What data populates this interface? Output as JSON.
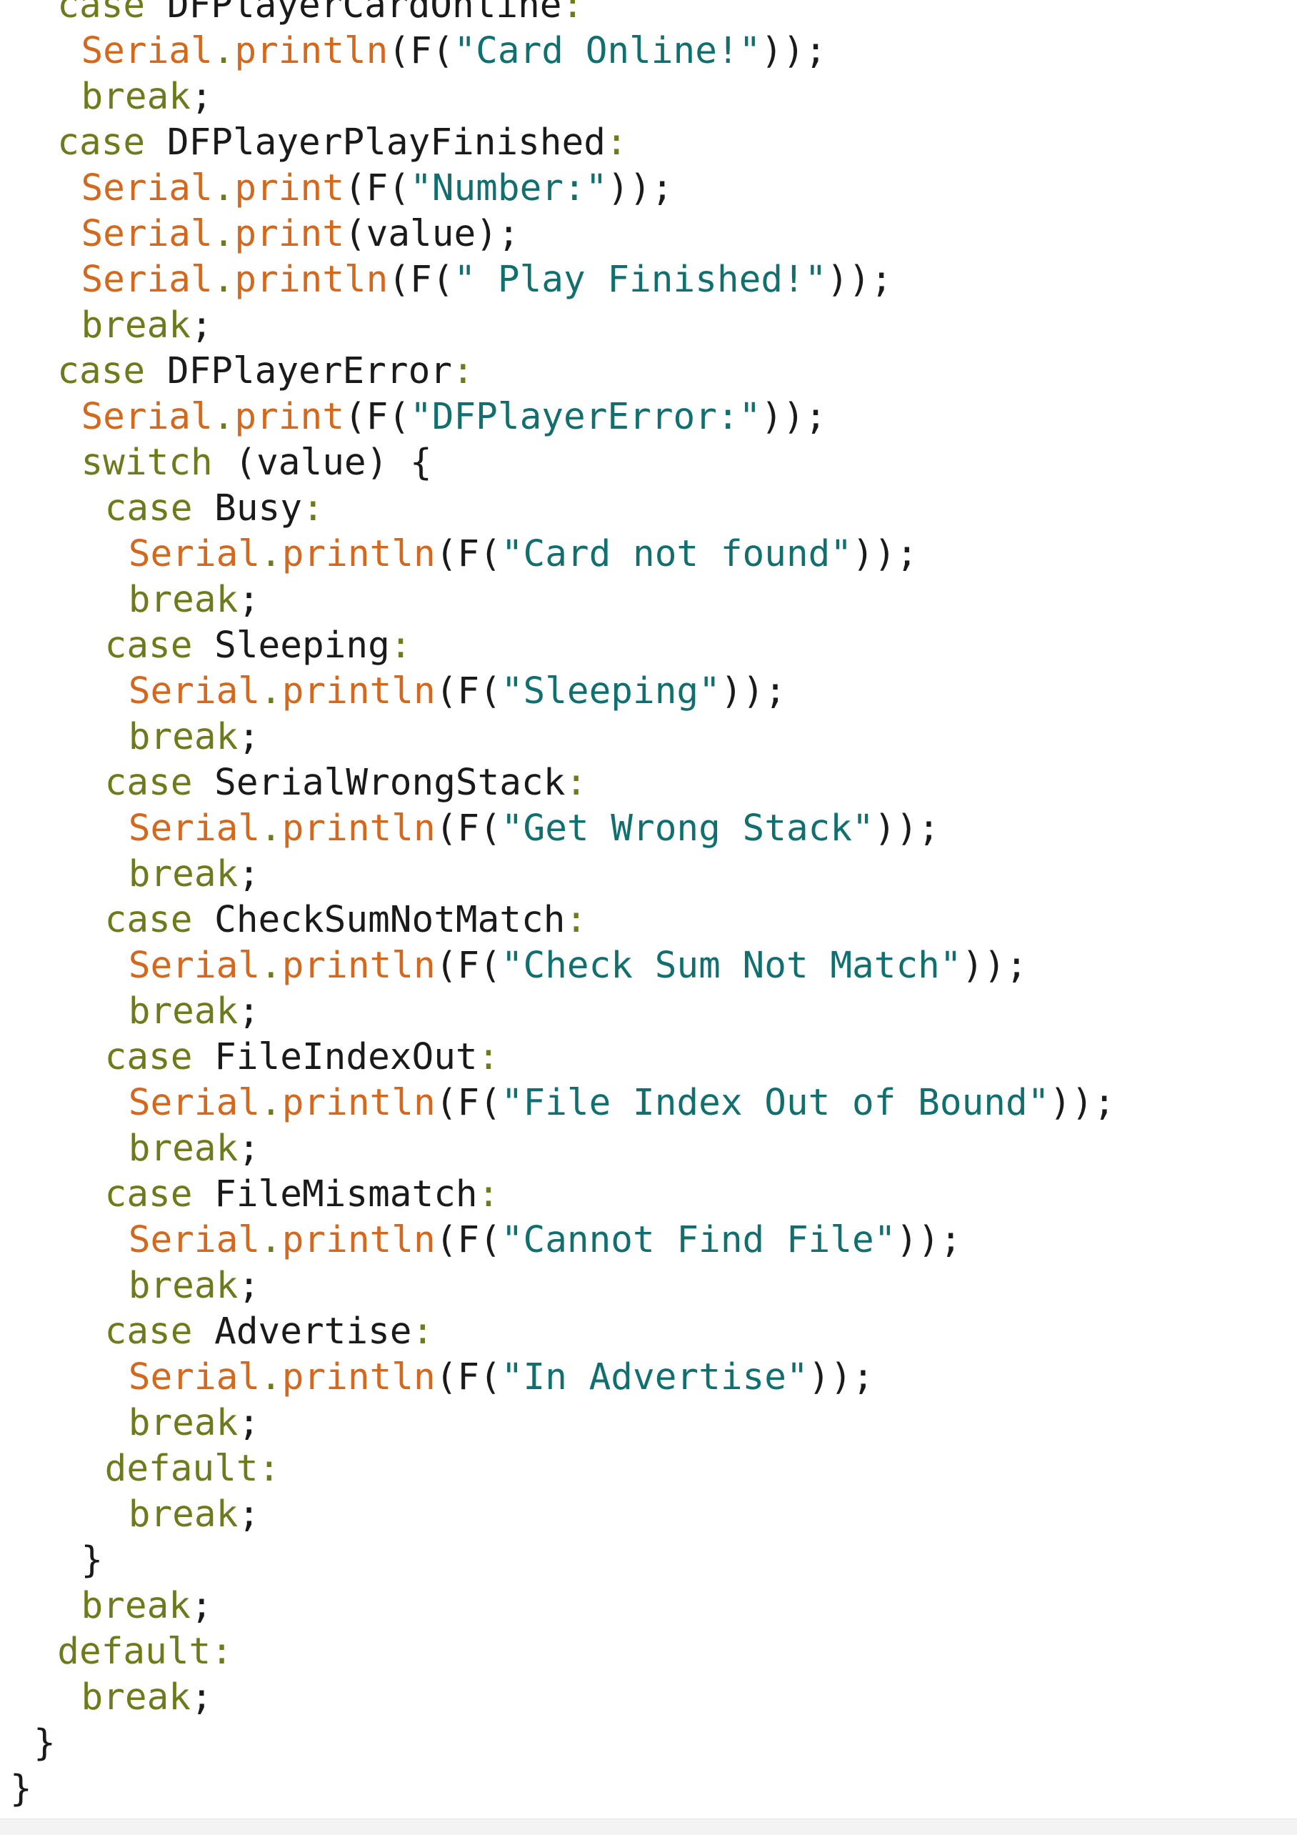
{
  "editor": {
    "colors": {
      "keyword": "#6e7a1c",
      "serial": "#d3681f",
      "string": "#11706f",
      "plain": "#1a1a1a",
      "background": "#ffffff"
    },
    "lines": [
      {
        "indent": 4,
        "tokens": [
          {
            "t": "case",
            "c": "keyword"
          },
          {
            "t": " DFPlayerCardOnline",
            "c": "plain"
          },
          {
            "t": ":",
            "c": "colon"
          }
        ]
      },
      {
        "indent": 6,
        "tokens": [
          {
            "t": "Serial",
            "c": "serial"
          },
          {
            "t": ".",
            "c": "dot"
          },
          {
            "t": "println",
            "c": "method"
          },
          {
            "t": "(F(",
            "c": "plain"
          },
          {
            "t": "\"Card Online!\"",
            "c": "string"
          },
          {
            "t": "));",
            "c": "plain"
          }
        ]
      },
      {
        "indent": 6,
        "tokens": [
          {
            "t": "break",
            "c": "keyword"
          },
          {
            "t": ";",
            "c": "plain"
          }
        ]
      },
      {
        "indent": 4,
        "tokens": [
          {
            "t": "case",
            "c": "keyword"
          },
          {
            "t": " DFPlayerPlayFinished",
            "c": "plain"
          },
          {
            "t": ":",
            "c": "colon"
          }
        ]
      },
      {
        "indent": 6,
        "tokens": [
          {
            "t": "Serial",
            "c": "serial"
          },
          {
            "t": ".",
            "c": "dot"
          },
          {
            "t": "print",
            "c": "method"
          },
          {
            "t": "(F(",
            "c": "plain"
          },
          {
            "t": "\"Number:\"",
            "c": "string"
          },
          {
            "t": "));",
            "c": "plain"
          }
        ]
      },
      {
        "indent": 6,
        "tokens": [
          {
            "t": "Serial",
            "c": "serial"
          },
          {
            "t": ".",
            "c": "dot"
          },
          {
            "t": "print",
            "c": "method"
          },
          {
            "t": "(value);",
            "c": "plain"
          }
        ]
      },
      {
        "indent": 6,
        "tokens": [
          {
            "t": "Serial",
            "c": "serial"
          },
          {
            "t": ".",
            "c": "dot"
          },
          {
            "t": "println",
            "c": "method"
          },
          {
            "t": "(F(",
            "c": "plain"
          },
          {
            "t": "\" Play Finished!\"",
            "c": "string"
          },
          {
            "t": "));",
            "c": "plain"
          }
        ]
      },
      {
        "indent": 6,
        "tokens": [
          {
            "t": "break",
            "c": "keyword"
          },
          {
            "t": ";",
            "c": "plain"
          }
        ]
      },
      {
        "indent": 4,
        "tokens": [
          {
            "t": "case",
            "c": "keyword"
          },
          {
            "t": " DFPlayerError",
            "c": "plain"
          },
          {
            "t": ":",
            "c": "colon"
          }
        ]
      },
      {
        "indent": 6,
        "tokens": [
          {
            "t": "Serial",
            "c": "serial"
          },
          {
            "t": ".",
            "c": "dot"
          },
          {
            "t": "print",
            "c": "method"
          },
          {
            "t": "(F(",
            "c": "plain"
          },
          {
            "t": "\"DFPlayerError:\"",
            "c": "string"
          },
          {
            "t": "));",
            "c": "plain"
          }
        ]
      },
      {
        "indent": 6,
        "tokens": [
          {
            "t": "switch",
            "c": "keyword"
          },
          {
            "t": " (value) {",
            "c": "plain"
          }
        ]
      },
      {
        "indent": 8,
        "tokens": [
          {
            "t": "case",
            "c": "keyword"
          },
          {
            "t": " Busy",
            "c": "plain"
          },
          {
            "t": ":",
            "c": "colon"
          }
        ]
      },
      {
        "indent": 10,
        "tokens": [
          {
            "t": "Serial",
            "c": "serial"
          },
          {
            "t": ".",
            "c": "dot"
          },
          {
            "t": "println",
            "c": "method"
          },
          {
            "t": "(F(",
            "c": "plain"
          },
          {
            "t": "\"Card not found\"",
            "c": "string"
          },
          {
            "t": "));",
            "c": "plain"
          }
        ]
      },
      {
        "indent": 10,
        "tokens": [
          {
            "t": "break",
            "c": "keyword"
          },
          {
            "t": ";",
            "c": "plain"
          }
        ]
      },
      {
        "indent": 8,
        "tokens": [
          {
            "t": "case",
            "c": "keyword"
          },
          {
            "t": " Sleeping",
            "c": "plain"
          },
          {
            "t": ":",
            "c": "colon"
          }
        ]
      },
      {
        "indent": 10,
        "tokens": [
          {
            "t": "Serial",
            "c": "serial"
          },
          {
            "t": ".",
            "c": "dot"
          },
          {
            "t": "println",
            "c": "method"
          },
          {
            "t": "(F(",
            "c": "plain"
          },
          {
            "t": "\"Sleeping\"",
            "c": "string"
          },
          {
            "t": "));",
            "c": "plain"
          }
        ]
      },
      {
        "indent": 10,
        "tokens": [
          {
            "t": "break",
            "c": "keyword"
          },
          {
            "t": ";",
            "c": "plain"
          }
        ]
      },
      {
        "indent": 8,
        "tokens": [
          {
            "t": "case",
            "c": "keyword"
          },
          {
            "t": " SerialWrongStack",
            "c": "plain"
          },
          {
            "t": ":",
            "c": "colon"
          }
        ]
      },
      {
        "indent": 10,
        "tokens": [
          {
            "t": "Serial",
            "c": "serial"
          },
          {
            "t": ".",
            "c": "dot"
          },
          {
            "t": "println",
            "c": "method"
          },
          {
            "t": "(F(",
            "c": "plain"
          },
          {
            "t": "\"Get Wrong Stack\"",
            "c": "string"
          },
          {
            "t": "));",
            "c": "plain"
          }
        ]
      },
      {
        "indent": 10,
        "tokens": [
          {
            "t": "break",
            "c": "keyword"
          },
          {
            "t": ";",
            "c": "plain"
          }
        ]
      },
      {
        "indent": 8,
        "tokens": [
          {
            "t": "case",
            "c": "keyword"
          },
          {
            "t": " CheckSumNotMatch",
            "c": "plain"
          },
          {
            "t": ":",
            "c": "colon"
          }
        ]
      },
      {
        "indent": 10,
        "tokens": [
          {
            "t": "Serial",
            "c": "serial"
          },
          {
            "t": ".",
            "c": "dot"
          },
          {
            "t": "println",
            "c": "method"
          },
          {
            "t": "(F(",
            "c": "plain"
          },
          {
            "t": "\"Check Sum Not Match\"",
            "c": "string"
          },
          {
            "t": "));",
            "c": "plain"
          }
        ]
      },
      {
        "indent": 10,
        "tokens": [
          {
            "t": "break",
            "c": "keyword"
          },
          {
            "t": ";",
            "c": "plain"
          }
        ]
      },
      {
        "indent": 8,
        "tokens": [
          {
            "t": "case",
            "c": "keyword"
          },
          {
            "t": " FileIndexOut",
            "c": "plain"
          },
          {
            "t": ":",
            "c": "colon"
          }
        ]
      },
      {
        "indent": 10,
        "tokens": [
          {
            "t": "Serial",
            "c": "serial"
          },
          {
            "t": ".",
            "c": "dot"
          },
          {
            "t": "println",
            "c": "method"
          },
          {
            "t": "(F(",
            "c": "plain"
          },
          {
            "t": "\"File Index Out of Bound\"",
            "c": "string"
          },
          {
            "t": "));",
            "c": "plain"
          }
        ]
      },
      {
        "indent": 10,
        "tokens": [
          {
            "t": "break",
            "c": "keyword"
          },
          {
            "t": ";",
            "c": "plain"
          }
        ]
      },
      {
        "indent": 8,
        "tokens": [
          {
            "t": "case",
            "c": "keyword"
          },
          {
            "t": " FileMismatch",
            "c": "plain"
          },
          {
            "t": ":",
            "c": "colon"
          }
        ]
      },
      {
        "indent": 10,
        "tokens": [
          {
            "t": "Serial",
            "c": "serial"
          },
          {
            "t": ".",
            "c": "dot"
          },
          {
            "t": "println",
            "c": "method"
          },
          {
            "t": "(F(",
            "c": "plain"
          },
          {
            "t": "\"Cannot Find File\"",
            "c": "string"
          },
          {
            "t": "));",
            "c": "plain"
          }
        ]
      },
      {
        "indent": 10,
        "tokens": [
          {
            "t": "break",
            "c": "keyword"
          },
          {
            "t": ";",
            "c": "plain"
          }
        ]
      },
      {
        "indent": 8,
        "tokens": [
          {
            "t": "case",
            "c": "keyword"
          },
          {
            "t": " Advertise",
            "c": "plain"
          },
          {
            "t": ":",
            "c": "colon"
          }
        ]
      },
      {
        "indent": 10,
        "tokens": [
          {
            "t": "Serial",
            "c": "serial"
          },
          {
            "t": ".",
            "c": "dot"
          },
          {
            "t": "println",
            "c": "method"
          },
          {
            "t": "(F(",
            "c": "plain"
          },
          {
            "t": "\"In Advertise\"",
            "c": "string"
          },
          {
            "t": "));",
            "c": "plain"
          }
        ]
      },
      {
        "indent": 10,
        "tokens": [
          {
            "t": "break",
            "c": "keyword"
          },
          {
            "t": ";",
            "c": "plain"
          }
        ]
      },
      {
        "indent": 8,
        "tokens": [
          {
            "t": "default",
            "c": "keyword"
          },
          {
            "t": ":",
            "c": "colon"
          }
        ]
      },
      {
        "indent": 10,
        "tokens": [
          {
            "t": "break",
            "c": "keyword"
          },
          {
            "t": ";",
            "c": "plain"
          }
        ]
      },
      {
        "indent": 6,
        "tokens": [
          {
            "t": "}",
            "c": "plain"
          }
        ]
      },
      {
        "indent": 6,
        "tokens": [
          {
            "t": "break",
            "c": "keyword"
          },
          {
            "t": ";",
            "c": "plain"
          }
        ]
      },
      {
        "indent": 4,
        "tokens": [
          {
            "t": "default",
            "c": "keyword"
          },
          {
            "t": ":",
            "c": "colon"
          }
        ]
      },
      {
        "indent": 6,
        "tokens": [
          {
            "t": "break",
            "c": "keyword"
          },
          {
            "t": ";",
            "c": "plain"
          }
        ]
      },
      {
        "indent": 2,
        "tokens": [
          {
            "t": "}",
            "c": "plain"
          }
        ]
      },
      {
        "indent": 0,
        "tokens": [
          {
            "t": "}",
            "c": "plain"
          }
        ]
      }
    ]
  }
}
